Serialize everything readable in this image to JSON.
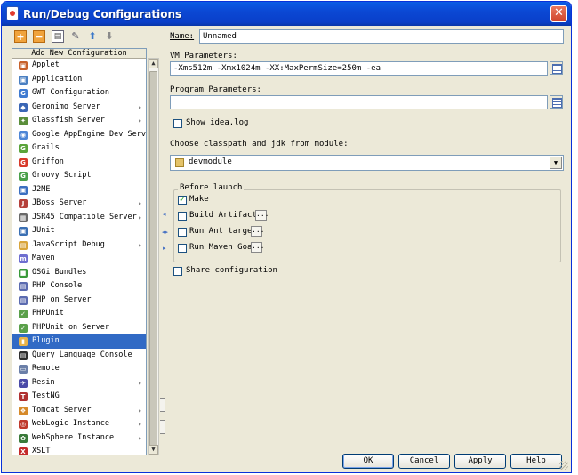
{
  "window": {
    "title": "Run/Debug Configurations",
    "close_glyph": "✕"
  },
  "toolbar": {
    "add_icon": "+",
    "remove_icon": "−",
    "copy_icon": "▤",
    "edit_icon": "✎",
    "up_icon": "⬆",
    "down_icon": "⬇"
  },
  "tree": {
    "header": "Add New Configuration",
    "items": [
      {
        "label": "Applet",
        "icon": "applet-icon",
        "color": "#c7612a",
        "glyph": "▣",
        "arrow": false
      },
      {
        "label": "Application",
        "icon": "application-icon",
        "color": "#4a7fc1",
        "glyph": "▣",
        "arrow": false
      },
      {
        "label": "GWT Configuration",
        "icon": "gwt-icon",
        "color": "#3f7bd1",
        "glyph": "G",
        "arrow": false
      },
      {
        "label": "Geronimo Server",
        "icon": "geronimo-icon",
        "color": "#3a66b5",
        "glyph": "◆",
        "arrow": true
      },
      {
        "label": "Glassfish Server",
        "icon": "glassfish-icon",
        "color": "#5a8e3a",
        "glyph": "✦",
        "arrow": true
      },
      {
        "label": "Google AppEngine Dev Server",
        "icon": "appengine-icon",
        "color": "#4d86d6",
        "glyph": "◉",
        "arrow": false
      },
      {
        "label": "Grails",
        "icon": "grails-icon",
        "color": "#5aa43a",
        "glyph": "G",
        "arrow": false
      },
      {
        "label": "Griffon",
        "icon": "griffon-icon",
        "color": "#d83a2a",
        "glyph": "G",
        "arrow": false
      },
      {
        "label": "Groovy Script",
        "icon": "groovy-icon",
        "color": "#4aa04a",
        "glyph": "G",
        "arrow": false
      },
      {
        "label": "J2ME",
        "icon": "j2me-icon",
        "color": "#3b6fc0",
        "glyph": "▣",
        "arrow": false
      },
      {
        "label": "JBoss Server",
        "icon": "jboss-icon",
        "color": "#b5403a",
        "glyph": "J",
        "arrow": true
      },
      {
        "label": "JSR45 Compatible Server",
        "icon": "jsr45-icon",
        "color": "#6a6a6a",
        "glyph": "▦",
        "arrow": true
      },
      {
        "label": "JUnit",
        "icon": "junit-icon",
        "color": "#3a6fb3",
        "glyph": "▣",
        "arrow": false
      },
      {
        "label": "JavaScript Debug",
        "icon": "javascript-icon",
        "color": "#d9a53a",
        "glyph": "▤",
        "arrow": true
      },
      {
        "label": "Maven",
        "icon": "maven-icon",
        "color": "#6e6ed0",
        "glyph": "m",
        "arrow": false
      },
      {
        "label": "OSGi Bundles",
        "icon": "osgi-icon",
        "color": "#3a9a3a",
        "glyph": "■",
        "arrow": false
      },
      {
        "label": "PHP Console",
        "icon": "php-console-icon",
        "color": "#5b6bb0",
        "glyph": "▤",
        "arrow": false
      },
      {
        "label": "PHP on Server",
        "icon": "php-server-icon",
        "color": "#5b6bb0",
        "glyph": "▤",
        "arrow": false
      },
      {
        "label": "PHPUnit",
        "icon": "phpunit-icon",
        "color": "#5aa04a",
        "glyph": "✓",
        "arrow": false
      },
      {
        "label": "PHPUnit on Server",
        "icon": "phpunit-server-icon",
        "color": "#5aa04a",
        "glyph": "✓",
        "arrow": false
      },
      {
        "label": "Plugin",
        "icon": "plugin-icon",
        "color": "#e8b34a",
        "glyph": "▮",
        "arrow": false
      },
      {
        "label": "Query Language Console",
        "icon": "query-console-icon",
        "color": "#2e2e2e",
        "glyph": "▤",
        "arrow": false
      },
      {
        "label": "Remote",
        "icon": "remote-icon",
        "color": "#6b7fa8",
        "glyph": "▭",
        "arrow": false
      },
      {
        "label": "Resin",
        "icon": "resin-icon",
        "color": "#4a4aa8",
        "glyph": "✈",
        "arrow": true
      },
      {
        "label": "TestNG",
        "icon": "testng-icon",
        "color": "#b03030",
        "glyph": "T",
        "arrow": false
      },
      {
        "label": "Tomcat Server",
        "icon": "tomcat-icon",
        "color": "#d68a2a",
        "glyph": "❖",
        "arrow": true
      },
      {
        "label": "WebLogic Instance",
        "icon": "weblogic-icon",
        "color": "#c0392b",
        "glyph": "◎",
        "arrow": true
      },
      {
        "label": "WebSphere Instance",
        "icon": "websphere-icon",
        "color": "#3a7a3a",
        "glyph": "✿",
        "arrow": true
      },
      {
        "label": "XSLT",
        "icon": "xslt-icon",
        "color": "#c42a2a",
        "glyph": "X",
        "arrow": false
      }
    ],
    "selected_index": 20,
    "arrow_glyph": "▸"
  },
  "form": {
    "name_label": "Name:",
    "name_value": "Unnamed",
    "vm_label": "VM Parameters:",
    "vm_value": "-Xms512m -Xmx1024m -XX:MaxPermSize=250m -ea",
    "program_label": "Program Parameters:",
    "program_value": "",
    "show_log_label": "Show idea.log",
    "classpath_label": "Choose classpath and jdk from module:",
    "module_value": "devmodule",
    "before_launch_label": "Before launch",
    "make_label": "Make",
    "build_artifacts_label": "Build Artifacts",
    "ant_label": "Run Ant target",
    "maven_goal_label": "Run Maven Goal",
    "ellipsis": "...",
    "share_label": "Share configuration",
    "check_glyph": "✓"
  },
  "buttons": {
    "ok": "OK",
    "cancel": "Cancel",
    "apply": "Apply",
    "help": "Help"
  },
  "scrollbar": {
    "up": "▲",
    "down": "▼"
  },
  "splitter": {
    "left": "◂",
    "mid": "◂▸",
    "right": "▸"
  }
}
